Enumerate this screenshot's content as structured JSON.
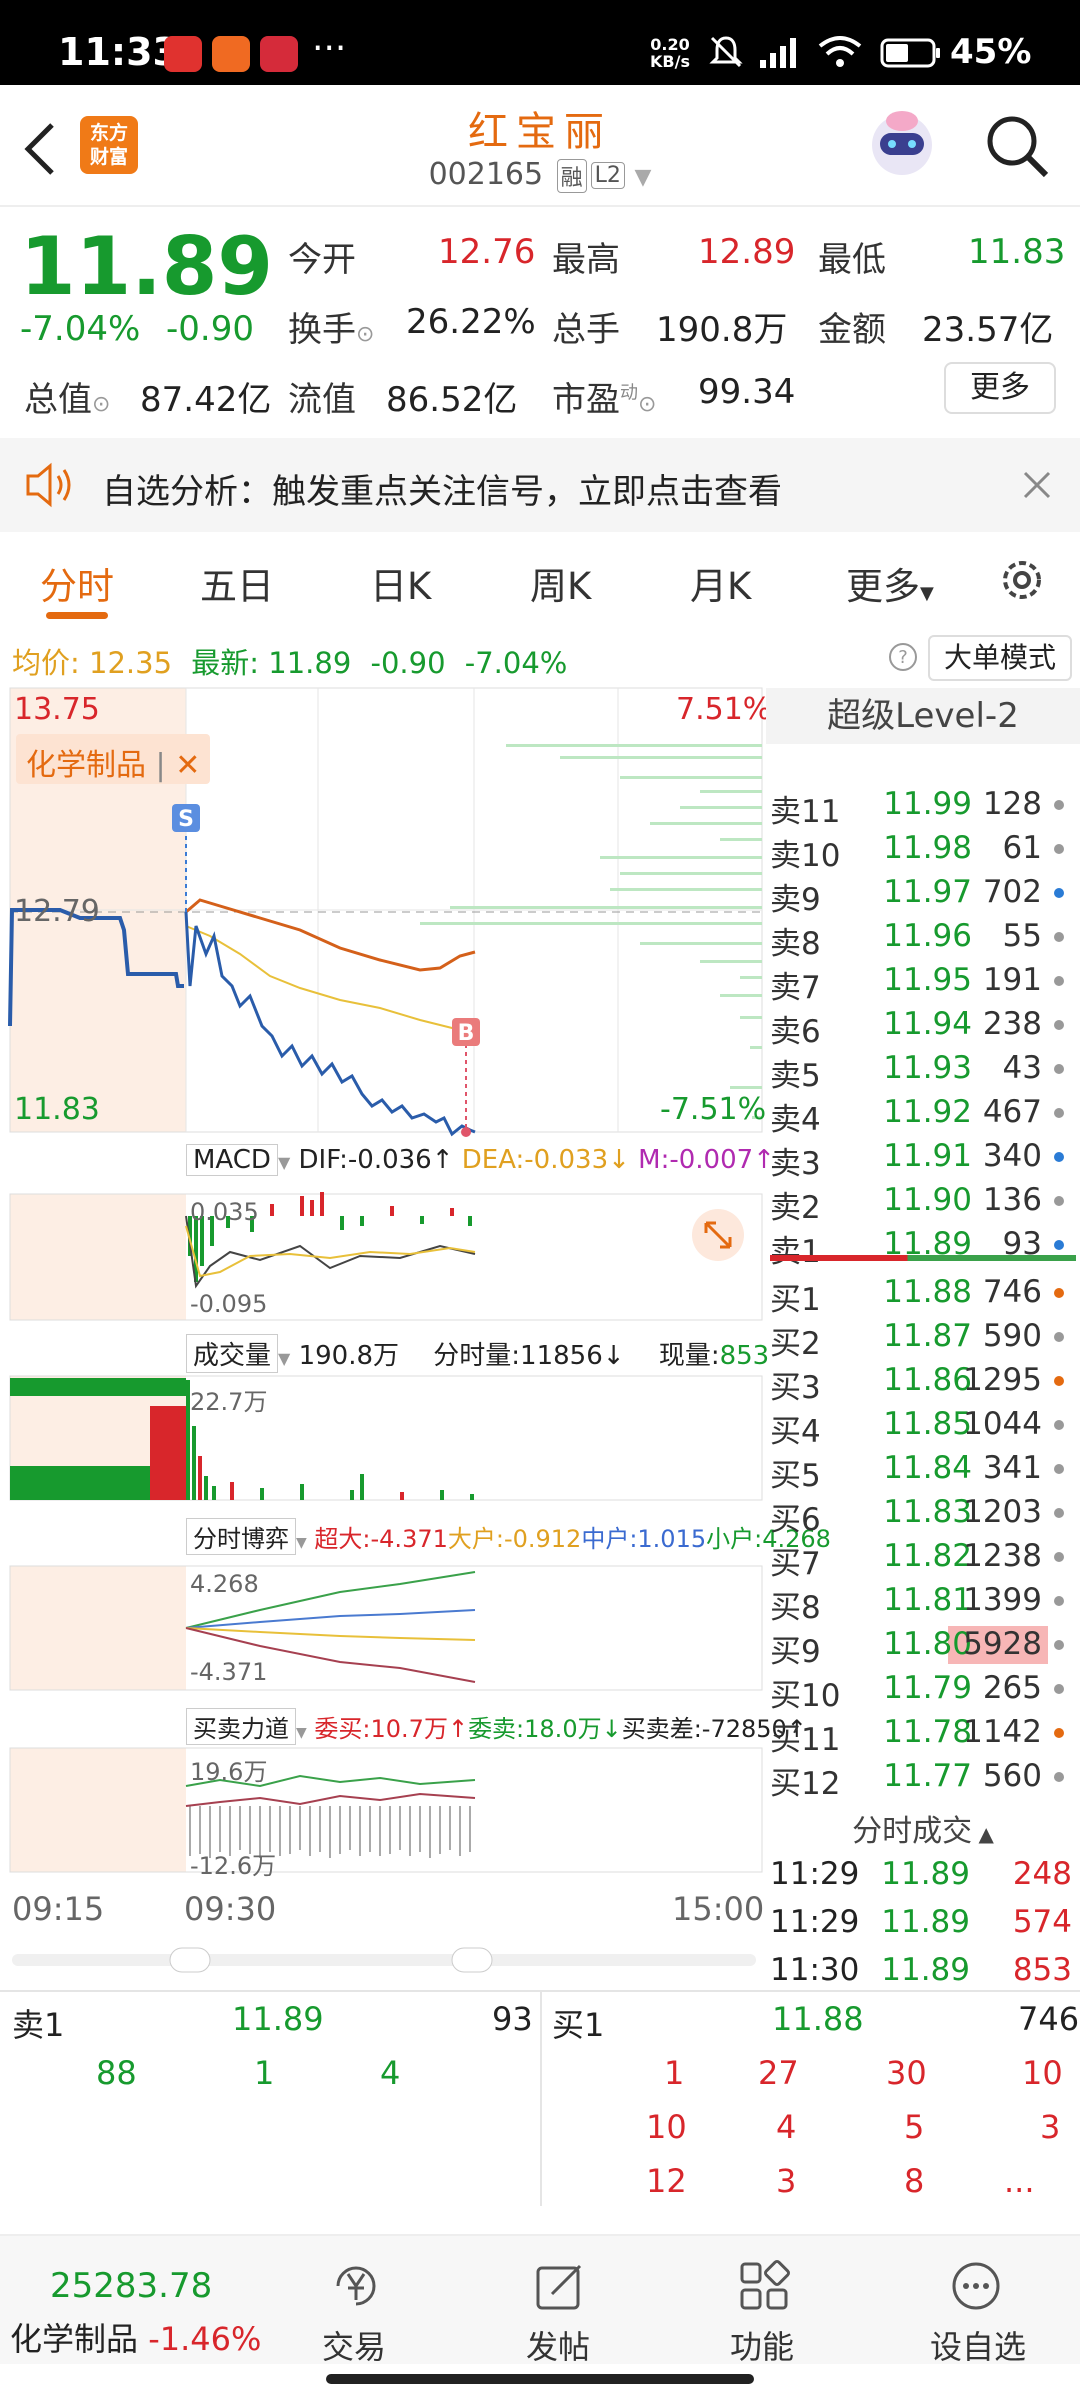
{
  "status_bar": {
    "time": "11:33",
    "dots": "···",
    "net_speed_top": "0.20",
    "net_speed_bottom": "KB/s",
    "battery": "45%"
  },
  "header": {
    "logo_line1": "东方",
    "logo_line2": "财富",
    "stock_name": "红宝丽",
    "stock_code": "002165",
    "tag_margin": "融",
    "tag_level": "L2"
  },
  "quote": {
    "price": "11.89",
    "change_pct": "-7.04%",
    "change": "-0.90",
    "open_label": "今开",
    "open": "12.76",
    "high_label": "最高",
    "high": "12.89",
    "low_label": "最低",
    "low": "11.83",
    "turnover_label": "换手",
    "turnover": "26.22%",
    "volume_label": "总手",
    "volume": "190.8万",
    "amount_label": "金额",
    "amount": "23.57亿",
    "mktcap_label": "总值",
    "mktcap": "87.42亿",
    "float_label": "流值",
    "float": "86.52亿",
    "pe_label": "市盈",
    "pe_sup": "动",
    "pe": "99.34",
    "more": "更多"
  },
  "alert": {
    "text": "自选分析：触发重点关注信号，立即点击查看"
  },
  "tabs": [
    "分时",
    "五日",
    "日K",
    "周K",
    "月K",
    "更多"
  ],
  "info_line": {
    "avg_label": "均价:",
    "avg": "12.35",
    "latest_label": "最新:",
    "latest": "11.89",
    "change": "-0.90",
    "change_pct": "-7.04%",
    "big_order": "大单模式"
  },
  "chart": {
    "max_price": "13.75",
    "min_price": "11.83",
    "ref_price": "12.79",
    "max_pct": "7.51%",
    "min_pct": "-7.51%",
    "sector_tag": "化学制品",
    "signal_s": "S",
    "signal_b": "B",
    "level2_title": "超级Level-2",
    "time_start": "09:15",
    "time_open": "09:30",
    "time_end": "15:00"
  },
  "indicators": {
    "macd": {
      "name": "MACD",
      "dif": "DIF:-0.036↑",
      "dea": "DEA:-0.033↓",
      "m": "M:-0.007↑",
      "top": "0.035",
      "bottom": "-0.095"
    },
    "volume": {
      "name": "成交量",
      "total": "190.8万",
      "tick": "分时量:11856↓",
      "now_label": "现量:",
      "now": "853",
      "axis": "22.7万"
    },
    "game": {
      "name": "分时博弈",
      "super": "超大:-4.371",
      "big": "大户:-0.912",
      "mid": "中户:1.015",
      "small": "小户:4.268",
      "top": "4.268",
      "bottom": "-4.371"
    },
    "force": {
      "name": "买卖力道",
      "buy": "委买:10.7万↑",
      "sell": "委卖:18.0万↓",
      "diff": "买卖差:-72850↑",
      "top": "19.6万",
      "bottom": "-12.6万"
    }
  },
  "order_book": {
    "asks": [
      {
        "label": "卖11",
        "price": "11.99",
        "vol": "128"
      },
      {
        "label": "卖10",
        "price": "11.98",
        "vol": "61"
      },
      {
        "label": "卖9",
        "price": "11.97",
        "vol": "702"
      },
      {
        "label": "卖8",
        "price": "11.96",
        "vol": "55"
      },
      {
        "label": "卖7",
        "price": "11.95",
        "vol": "191"
      },
      {
        "label": "卖6",
        "price": "11.94",
        "vol": "238"
      },
      {
        "label": "卖5",
        "price": "11.93",
        "vol": "43"
      },
      {
        "label": "卖4",
        "price": "11.92",
        "vol": "467"
      },
      {
        "label": "卖3",
        "price": "11.91",
        "vol": "340"
      },
      {
        "label": "卖2",
        "price": "11.90",
        "vol": "136"
      },
      {
        "label": "卖1",
        "price": "11.89",
        "vol": "93"
      }
    ],
    "bids": [
      {
        "label": "买1",
        "price": "11.88",
        "vol": "746"
      },
      {
        "label": "买2",
        "price": "11.87",
        "vol": "590"
      },
      {
        "label": "买3",
        "price": "11.86",
        "vol": "1295"
      },
      {
        "label": "买4",
        "price": "11.85",
        "vol": "1044"
      },
      {
        "label": "买5",
        "price": "11.84",
        "vol": "341"
      },
      {
        "label": "买6",
        "price": "11.83",
        "vol": "1203"
      },
      {
        "label": "买7",
        "price": "11.82",
        "vol": "1238"
      },
      {
        "label": "买8",
        "price": "11.81",
        "vol": "1399"
      },
      {
        "label": "买9",
        "price": "11.80",
        "vol": "5928"
      },
      {
        "label": "买10",
        "price": "11.79",
        "vol": "265"
      },
      {
        "label": "买11",
        "price": "11.78",
        "vol": "1142"
      },
      {
        "label": "买12",
        "price": "11.77",
        "vol": "560"
      }
    ]
  },
  "ticks": {
    "title": "分时成交",
    "rows": [
      {
        "time": "11:29",
        "price": "11.89",
        "vol": "248"
      },
      {
        "time": "11:29",
        "price": "11.89",
        "vol": "574"
      },
      {
        "time": "11:30",
        "price": "11.89",
        "vol": "853"
      }
    ]
  },
  "queue": {
    "sell_label": "卖1",
    "sell_price": "11.89",
    "sell_vol": "93",
    "buy_label": "买1",
    "buy_price": "11.88",
    "buy_vol": "746",
    "sell_orders": [
      "88",
      "1",
      "4"
    ],
    "buy_orders": [
      "1",
      "27",
      "30",
      "10",
      "10",
      "4",
      "5",
      "3",
      "12",
      "3",
      "8",
      "..."
    ]
  },
  "bottom_nav": {
    "index_value": "25283.78",
    "index_name": "化学制品",
    "index_change": "-1.46%",
    "items": [
      "交易",
      "发帖",
      "功能",
      "设自选"
    ]
  },
  "colors": {
    "up": "#d8262b",
    "down": "#179a2e",
    "accent": "#e46a10"
  }
}
